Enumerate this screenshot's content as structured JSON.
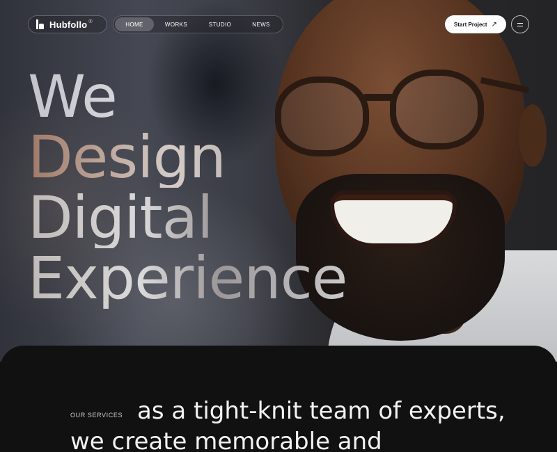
{
  "brand": {
    "name": "Hubfollo",
    "mark": "®"
  },
  "nav": {
    "items": [
      {
        "label": "HOME",
        "active": true
      },
      {
        "label": "WORKS",
        "active": false
      },
      {
        "label": "STUDIO",
        "active": false
      },
      {
        "label": "NEWS",
        "active": false
      }
    ]
  },
  "header": {
    "cta_label": "Start Project",
    "cta_icon": "arrow-up-right-icon",
    "menu_icon": "hamburger-icon"
  },
  "hero": {
    "headline_lines": [
      "We",
      "Design",
      "Digital",
      "Experience"
    ]
  },
  "services": {
    "label": "OUR SERVICES",
    "text": "as a tight-knit team of experts, we create memorable and"
  },
  "colors": {
    "section_bg": "#111111",
    "button_bg": "#ffffff"
  }
}
